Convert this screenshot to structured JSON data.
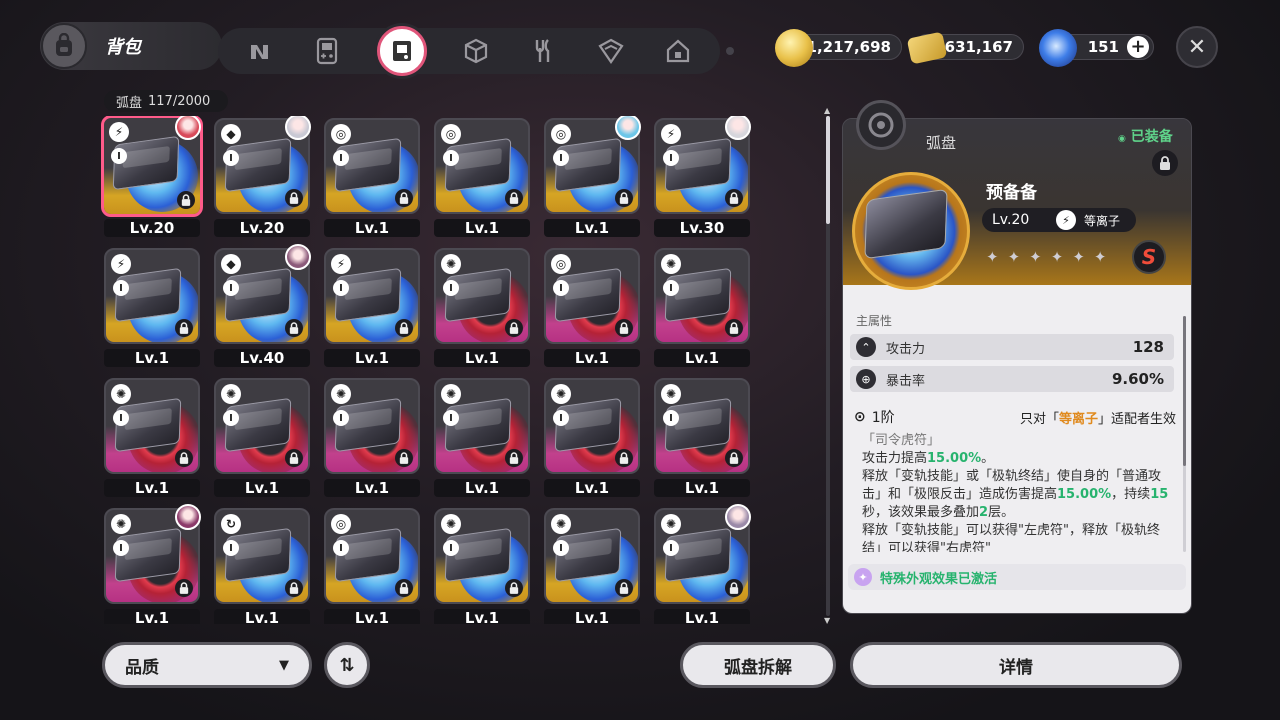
{
  "header": {
    "title": "背包",
    "bag_icon": "backpack-icon",
    "tabs": [
      {
        "icon": "n-logo-icon",
        "active": false
      },
      {
        "icon": "gameboy-icon",
        "active": false
      },
      {
        "icon": "disc-drive-icon",
        "active": true
      },
      {
        "icon": "cube-icon",
        "active": false
      },
      {
        "icon": "fork-knife-icon",
        "active": false
      },
      {
        "icon": "box-icon",
        "active": false
      },
      {
        "icon": "home-icon",
        "active": false
      }
    ],
    "currencies": [
      {
        "icon": "gold-coin-icon",
        "value": "1,217,698",
        "color": "#e9c14a"
      },
      {
        "icon": "ticket-icon",
        "value": "631,167",
        "color": "#d9b64a"
      },
      {
        "icon": "polychrome-icon",
        "value": "151",
        "color": "#3e7de8"
      }
    ],
    "add_label": "+",
    "close_label": "✕"
  },
  "inventory": {
    "label": "弧盘",
    "count": "117/2000"
  },
  "cards": [
    {
      "quality": "s",
      "level": "Lv.20",
      "attr": "⚡",
      "rank": "I",
      "avatar": "#d84a5a",
      "selected": true
    },
    {
      "quality": "s",
      "level": "Lv.20",
      "attr": "◆",
      "rank": "I",
      "avatar": "#c9c9d4"
    },
    {
      "quality": "s",
      "level": "Lv.1",
      "attr": "◎",
      "rank": "I",
      "avatar": null
    },
    {
      "quality": "s",
      "level": "Lv.1",
      "attr": "◎",
      "rank": "I",
      "avatar": null
    },
    {
      "quality": "s",
      "level": "Lv.1",
      "attr": "◎",
      "rank": "I",
      "avatar": "#6cc6e8"
    },
    {
      "quality": "s",
      "level": "Lv.30",
      "attr": "⚡",
      "rank": "I",
      "avatar": "#d6d6dc"
    },
    {
      "quality": "s",
      "level": "Lv.1",
      "attr": "⚡",
      "rank": "I",
      "avatar": null
    },
    {
      "quality": "s",
      "level": "Lv.40",
      "attr": "◆",
      "rank": "I",
      "avatar": "#8b5a7a"
    },
    {
      "quality": "s",
      "level": "Lv.1",
      "attr": "⚡",
      "rank": "I",
      "avatar": null
    },
    {
      "quality": "a",
      "level": "Lv.1",
      "attr": "✺",
      "rank": "I",
      "avatar": null
    },
    {
      "quality": "a",
      "level": "Lv.1",
      "attr": "◎",
      "rank": "I",
      "avatar": null
    },
    {
      "quality": "a",
      "level": "Lv.1",
      "attr": "✺",
      "rank": "I",
      "avatar": null
    },
    {
      "quality": "a",
      "level": "Lv.1",
      "attr": "✺",
      "rank": "I",
      "avatar": null
    },
    {
      "quality": "a",
      "level": "Lv.1",
      "attr": "✺",
      "rank": "I",
      "avatar": null
    },
    {
      "quality": "a",
      "level": "Lv.1",
      "attr": "✺",
      "rank": "I",
      "avatar": null
    },
    {
      "quality": "a",
      "level": "Lv.1",
      "attr": "✺",
      "rank": "I",
      "avatar": null
    },
    {
      "quality": "a",
      "level": "Lv.1",
      "attr": "✺",
      "rank": "I",
      "avatar": null
    },
    {
      "quality": "a",
      "level": "Lv.1",
      "attr": "✺",
      "rank": "I",
      "avatar": null
    },
    {
      "quality": "a",
      "level": "Lv.1",
      "attr": "✺",
      "rank": "I",
      "avatar": "#8b3a6a"
    },
    {
      "quality": "s",
      "level": "Lv.1",
      "attr": "↻",
      "rank": "I",
      "avatar": null
    },
    {
      "quality": "s",
      "level": "Lv.1",
      "attr": "◎",
      "rank": "I",
      "avatar": null
    },
    {
      "quality": "s",
      "level": "Lv.1",
      "attr": "✺",
      "rank": "I",
      "avatar": null
    },
    {
      "quality": "s",
      "level": "Lv.1",
      "attr": "✺",
      "rank": "I",
      "avatar": null
    },
    {
      "quality": "s",
      "level": "Lv.1",
      "attr": "✺",
      "rank": "I",
      "avatar": "#9a8aa8"
    }
  ],
  "bottom": {
    "quality_label": "品质",
    "sort_label": "⇅",
    "dismantle_label": "弧盘拆解",
    "detail_label": "详情"
  },
  "detail": {
    "type_label": "弧盘",
    "equipped_label": "已装备",
    "name": "预备备",
    "level": "Lv.20",
    "attr_icon": "⚡",
    "attr_name": "等离子",
    "stars": [
      "✦",
      "✦",
      "✦",
      "✦",
      "✦",
      "✦",
      "✦"
    ],
    "rank_badge": "S",
    "main_attr_label": "主属性",
    "stats": [
      {
        "icon": "attack-icon",
        "glyph": "⌃",
        "name": "攻击力",
        "value": "128"
      },
      {
        "icon": "crit-icon",
        "glyph": "⊕",
        "name": "暴击率",
        "value": "9.60%"
      }
    ],
    "tier_icon": "⊙",
    "tier": "1阶",
    "tier_cond_pre": "只对「",
    "tier_cond_hl": "等离子",
    "tier_cond_post": "」适配者生效",
    "desc": {
      "title": "「司令虎符」",
      "l1_a": "攻击力提高",
      "l1_v": "15.00%",
      "l1_b": "。",
      "l2_a": "释放「变轨技能」或「极轨终结」使自身的「普通攻击」和「极限反击」造成伤害提高",
      "l2_v": "15.00%",
      "l2_b": "，持续",
      "l2_v2": "15",
      "l2_c": "秒，该效果最多叠加",
      "l2_v3": "2",
      "l2_d": "层。",
      "l3": "释放「变轨技能」可以获得\"左虎符\"，释放「极轨终结」可以获得\"右虎符\""
    },
    "special_label": "特殊外观效果已激活"
  }
}
